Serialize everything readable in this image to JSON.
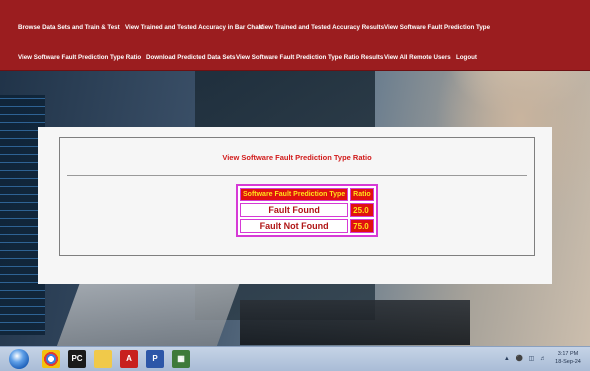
{
  "nav": {
    "row1": [
      "Browse Data Sets and Train & Test",
      "View Trained and Tested Accuracy in Bar Chart",
      "View Trained and Tested Accuracy Results",
      "View Software Fault Prediction Type"
    ],
    "row2": [
      "View Software Fault Prediction Type Ratio",
      "Download Predicted Data Sets",
      "View Software Fault Prediction Type Ratio Results",
      "View All Remote Users",
      "Logout"
    ]
  },
  "main": {
    "title": "View Software Fault Prediction Type Ratio",
    "table": {
      "headers": [
        "Software Fault Prediction Type",
        "Ratio"
      ],
      "rows": [
        {
          "type": "Fault Found",
          "ratio": "25.0"
        },
        {
          "type": "Fault Not Found",
          "ratio": "75.0"
        }
      ]
    }
  },
  "taskbar": {
    "icons": [
      "windows-start-icon",
      "chrome-icon",
      "pycharm-icon",
      "file-explorer-icon",
      "acrobat-icon",
      "python-icon",
      "terminal-icon"
    ],
    "clock_time": "3:17 PM",
    "clock_date": "18-Sep-24"
  },
  "colors": {
    "nav_bg": "#9b1d1f",
    "header_bg": "#e01010",
    "header_text": "#ffe11a",
    "border_accent": "#d63ad6",
    "title_text": "#d11b1b"
  }
}
